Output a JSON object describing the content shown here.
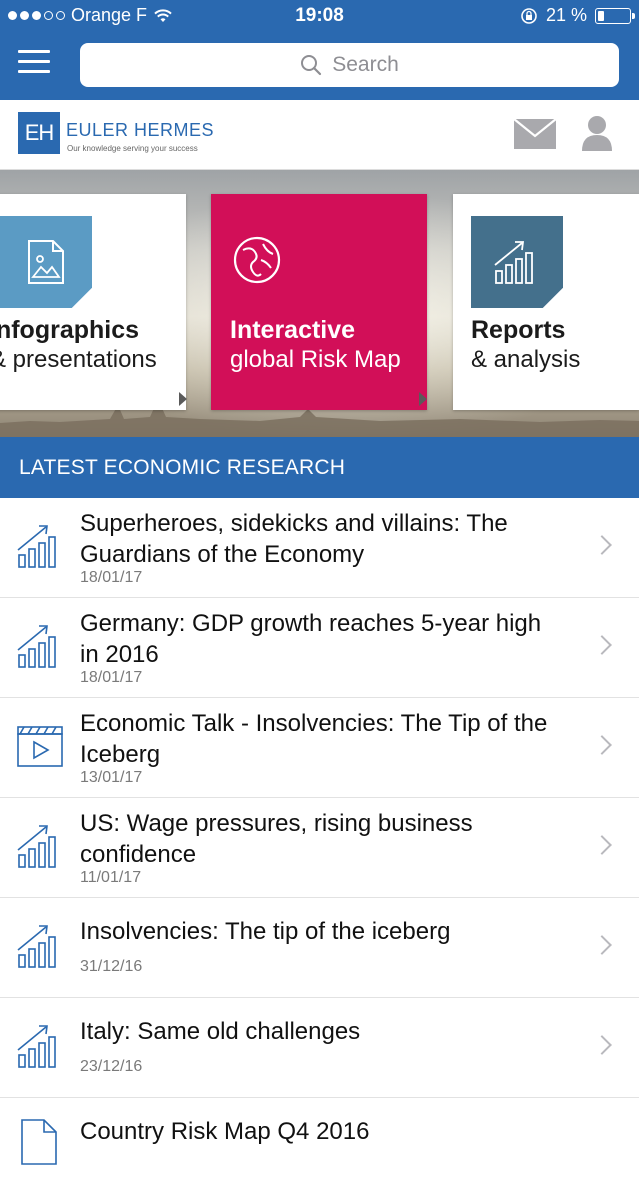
{
  "status_bar": {
    "carrier": "Orange F",
    "time": "19:08",
    "battery": "21 %",
    "battery_level": 0.21
  },
  "header": {
    "search_placeholder": "Search"
  },
  "brand": {
    "logo_mark": "EH",
    "name": "EULER HERMES",
    "tagline": "Our knowledge serving your success"
  },
  "hero": {
    "cards": [
      {
        "title": "Infographics",
        "subtitle": "& presentations",
        "icon": "image-file-icon"
      },
      {
        "title": "Interactive",
        "subtitle": "global Risk Map",
        "icon": "globe-icon"
      },
      {
        "title": "Reports",
        "subtitle": "& analysis",
        "icon": "growth-chart-icon"
      }
    ]
  },
  "research": {
    "heading": "LATEST ECONOMIC RESEARCH",
    "items": [
      {
        "title": "Superheroes, sidekicks and villains: The Guardians of the Economy",
        "date": "18/01/17",
        "icon": "growth-chart-icon"
      },
      {
        "title": "Germany: GDP growth reaches 5-year high in 2016",
        "date": "18/01/17",
        "icon": "growth-chart-icon"
      },
      {
        "title": "Economic Talk - Insolvencies: The Tip of the Iceberg",
        "date": "13/01/17",
        "icon": "video-icon"
      },
      {
        "title": "US: Wage pressures, rising business confidence",
        "date": "11/01/17",
        "icon": "growth-chart-icon"
      },
      {
        "title": "Insolvencies: The tip of the iceberg",
        "date": "31/12/16",
        "icon": "growth-chart-icon"
      },
      {
        "title": "Italy: Same old challenges",
        "date": "23/12/16",
        "icon": "growth-chart-icon"
      },
      {
        "title": "Country Risk Map Q4 2016",
        "date": "",
        "icon": "document-icon"
      }
    ]
  },
  "colors": {
    "brand_blue": "#2a69b0",
    "accent_red": "#d20f58",
    "tile_light_blue": "#5b9bc4",
    "tile_slate": "#44708c"
  }
}
